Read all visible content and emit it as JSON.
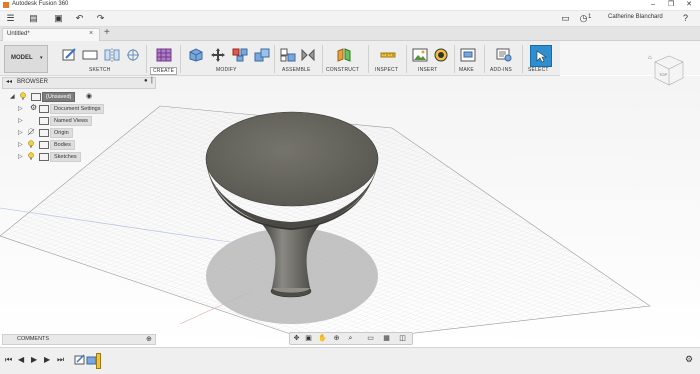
{
  "window": {
    "title": "Autodesk Fusion 360",
    "controls": [
      "minimize",
      "restore",
      "close"
    ]
  },
  "appbar": {
    "icons": [
      "menu-icon",
      "file-icon",
      "save-icon",
      "undo-icon",
      "redo-icon"
    ],
    "right_icons": [
      "notifications-icon",
      "clock-icon"
    ],
    "job_count": "1",
    "user_name": "Catherine Blanchard"
  },
  "tabs": [
    {
      "label": "Untitled*",
      "active": true
    }
  ],
  "ribbon": {
    "workspace": "MODEL",
    "groups": [
      {
        "label": "SKETCH",
        "icons": [
          "sketch-icon",
          "rectangle-icon",
          "mirror-icon",
          "offset-plane-icon"
        ]
      },
      {
        "label": "CREATE",
        "icons": [
          "create-form-icon"
        ]
      },
      {
        "label": "MODIFY",
        "icons": [
          "press-pull-icon",
          "move-icon",
          "split-body-icon",
          "combine-icon"
        ]
      },
      {
        "label": "ASSEMBLE",
        "icons": [
          "new-component-icon",
          "joint-icon"
        ]
      },
      {
        "label": "CONSTRUCT",
        "icons": [
          "construct-plane-icon"
        ]
      },
      {
        "label": "INSPECT",
        "icons": [
          "measure-icon"
        ]
      },
      {
        "label": "INSERT",
        "icons": [
          "insert-image-icon",
          "insert-decal-icon"
        ]
      },
      {
        "label": "MAKE",
        "icons": [
          "make-3d-print-icon"
        ]
      },
      {
        "label": "ADD-INS",
        "icons": [
          "scripts-icon"
        ]
      },
      {
        "label": "SELECT",
        "icons": [
          "select-icon"
        ]
      }
    ]
  },
  "browser": {
    "title": "BROWSER",
    "root": "(Unsaved)",
    "items": [
      {
        "label": "Document Settings"
      },
      {
        "label": "Named Views"
      },
      {
        "label": "Origin"
      },
      {
        "label": "Bodies"
      },
      {
        "label": "Sketches"
      }
    ]
  },
  "comments": {
    "title": "COMMENTS"
  },
  "navbar": {
    "icons": [
      "orbit-icon",
      "look-at-icon",
      "pan-icon",
      "zoom-icon",
      "fit-icon",
      "display-settings-icon",
      "grid-icon",
      "viewports-icon"
    ]
  },
  "timeline": {
    "controls": [
      "first-icon",
      "previous-icon",
      "play-icon",
      "next-icon",
      "last-icon"
    ],
    "features": [
      "sketch-feature-icon",
      "body-feature-icon"
    ]
  },
  "colors": {
    "ribbon_bg": "#eeeeee",
    "grid": "#c8c8c8",
    "body": "#5f5e59",
    "accent": "#e8762b"
  }
}
